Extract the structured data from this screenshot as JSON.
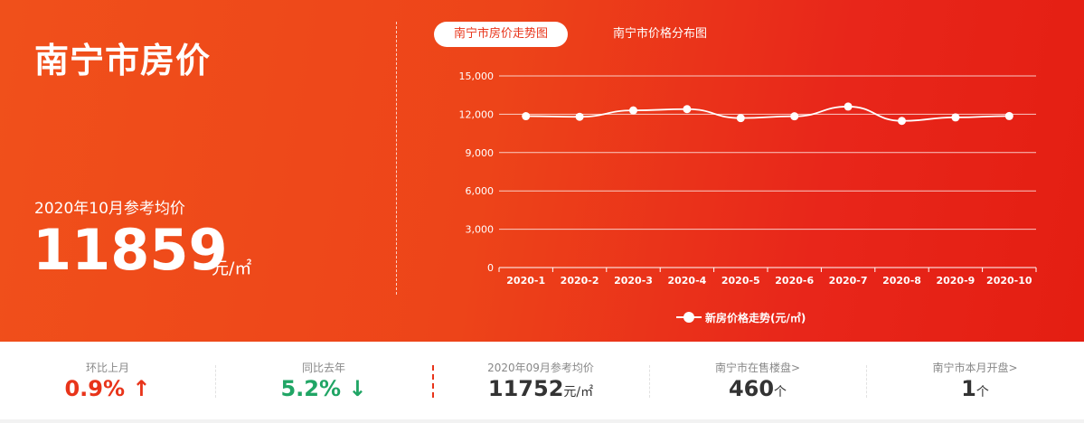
{
  "hero": {
    "title": "南宁市房价",
    "ref_label": "2020年10月参考均价",
    "ref_value": "11859",
    "ref_unit": "元/㎡"
  },
  "tabs": [
    {
      "label": "南宁市房价走势图",
      "active": true
    },
    {
      "label": "南宁市价格分布图",
      "active": false
    }
  ],
  "chart_data": {
    "type": "line",
    "categories": [
      "2020-1",
      "2020-2",
      "2020-3",
      "2020-4",
      "2020-5",
      "2020-6",
      "2020-7",
      "2020-8",
      "2020-9",
      "2020-10"
    ],
    "series": [
      {
        "name": "新房价格走势(元/㎡)",
        "values": [
          11850,
          11800,
          12300,
          12400,
          11700,
          11840,
          12600,
          11480,
          11752,
          11859
        ]
      }
    ],
    "yticks": [
      "0",
      "3,000",
      "6,000",
      "9,000",
      "12,000",
      "15,000"
    ],
    "ylim": [
      0,
      15000
    ],
    "grid": true,
    "legend_position": "bottom-center",
    "line_color": "#ffffff"
  },
  "stats": [
    {
      "label": "环比上月",
      "value": "0.9%",
      "arrow": "↑",
      "unit": "",
      "color": "up"
    },
    {
      "label": "同比去年",
      "value": "5.2%",
      "arrow": "↓",
      "unit": "",
      "color": "down"
    },
    {
      "label": "2020年09月参考均价",
      "value": "11752",
      "arrow": "",
      "unit": "元/㎡",
      "color": "dark"
    },
    {
      "label": "南宁市在售楼盘>",
      "value": "460",
      "arrow": "",
      "unit": "个",
      "color": "dark"
    },
    {
      "label": "南宁市本月开盘>",
      "value": "1",
      "arrow": "",
      "unit": "个",
      "color": "dark"
    }
  ],
  "colors": {
    "accent": "#e8341a",
    "up": "#e8341a",
    "down": "#20a565"
  }
}
